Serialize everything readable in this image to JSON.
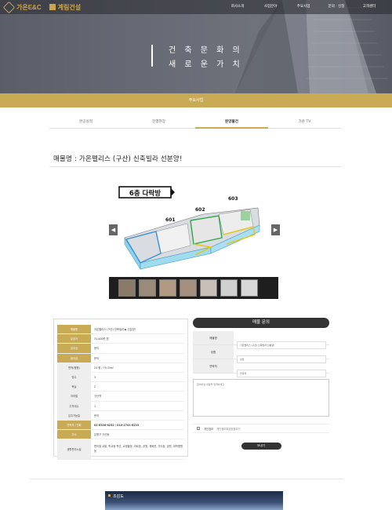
{
  "brand": {
    "logo1": "가온E&C",
    "logo2": "계림건설"
  },
  "nav": [
    "회사소개",
    "사업분야",
    "주요사업",
    "문의 · 신청",
    "고객센터"
  ],
  "hero": {
    "line1": "건 축 문 화 의",
    "line2": "새 로 운 가 치"
  },
  "section": "주요사업",
  "tabs": [
    {
      "label": "완공실적",
      "active": false
    },
    {
      "label": "진행현장",
      "active": false
    },
    {
      "label": "분양물건",
      "active": true
    },
    {
      "label": "가온 TV",
      "active": false
    }
  ],
  "property_title": "매물명 :  가온펠리스 (구산) 신축빌라 선분양!",
  "floorplan": {
    "badge": "6층 다락방",
    "unit_601": "601",
    "unit_602": "602",
    "unit_603": "603"
  },
  "slider": {
    "prev": "◀",
    "next": "▶"
  },
  "thumb_count": 7,
  "info_rows": [
    {
      "label": "매물명",
      "value": "가온팰리스 (구산) 신축빌라 ▶ 선분양!",
      "gold": true
    },
    {
      "label": "분양가",
      "value": "31,000만 원",
      "gold": true
    },
    {
      "label": "입주금",
      "value": "문의",
      "gold": true
    },
    {
      "label": "융자금",
      "value": "문의",
      "gold": true
    },
    {
      "label": "면적(평형)",
      "value": "24 평 / 79.33m²",
      "gold": false
    },
    {
      "label": "방수",
      "value": "3",
      "gold": false
    },
    {
      "label": "욕실",
      "value": "2",
      "gold": false
    },
    {
      "label": "지하철",
      "value": "구산역",
      "gold": false
    },
    {
      "label": "주차대수",
      "value": "1",
      "gold": false
    },
    {
      "label": "입주가능일",
      "value": "문의",
      "gold": false
    },
    {
      "label": "연락처 / 전화",
      "value": "02-6336-6252  /  010-2741-6233",
      "gold": true
    },
    {
      "label": "주소",
      "value": "은평구 구산동",
      "gold": true
    }
  ],
  "facilities": {
    "label": "생활편의시설",
    "value": "편의점 교통, 학교등 학군, 쇼핑몰등, 마트등, 공원, 체육관, 기타등, 공원, 대학병원 등"
  },
  "inquiry": {
    "header": "매물 문의",
    "fields": [
      {
        "label": "매물명",
        "value": "가온팰리스 (구산) 신축빌라 선분양!"
      },
      {
        "label": "성함",
        "placeholder": "성함"
      },
      {
        "label": "연락처",
        "placeholder": "연락처"
      }
    ],
    "message_placeholder": "문의하실 내용을 입력하세요",
    "agree_label": "개인정보",
    "agree_link": "개인정보취급방침보기",
    "send": "보내기"
  },
  "birdseye": "조감도"
}
